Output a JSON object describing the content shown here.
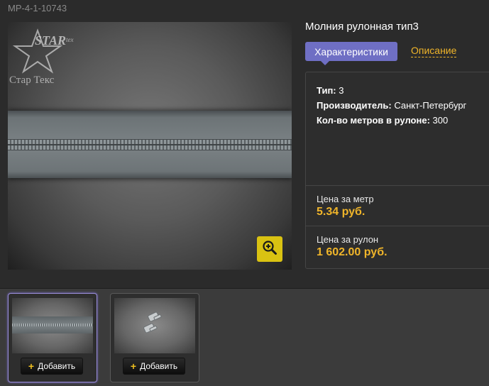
{
  "product": {
    "sku": "MP-4-1-10743",
    "title": "Молния рулонная тип3",
    "logo_text": "Стар Текс"
  },
  "tabs": {
    "characteristics": "Характеристики",
    "description": "Описание"
  },
  "specs": [
    {
      "label": "Тип:",
      "value": "3"
    },
    {
      "label": "Производитель:",
      "value": "Санкт-Петербург"
    },
    {
      "label": "Кол-во метров в рулоне:",
      "value": "300"
    }
  ],
  "prices": {
    "per_meter_label": "Цена за метр",
    "per_meter_value": "5.34 руб.",
    "per_roll_label": "Цена за рулон",
    "per_roll_value": "1 602.00 руб."
  },
  "thumbnails": [
    {
      "add_label": "Добавить"
    },
    {
      "add_label": "Добавить"
    }
  ],
  "icons": {
    "zoom": "zoom-in-icon",
    "plus": "plus-icon"
  },
  "colors": {
    "accent": "#f0b52a",
    "tab_active": "#6f6fc4",
    "zoom_button": "#d9c212"
  }
}
